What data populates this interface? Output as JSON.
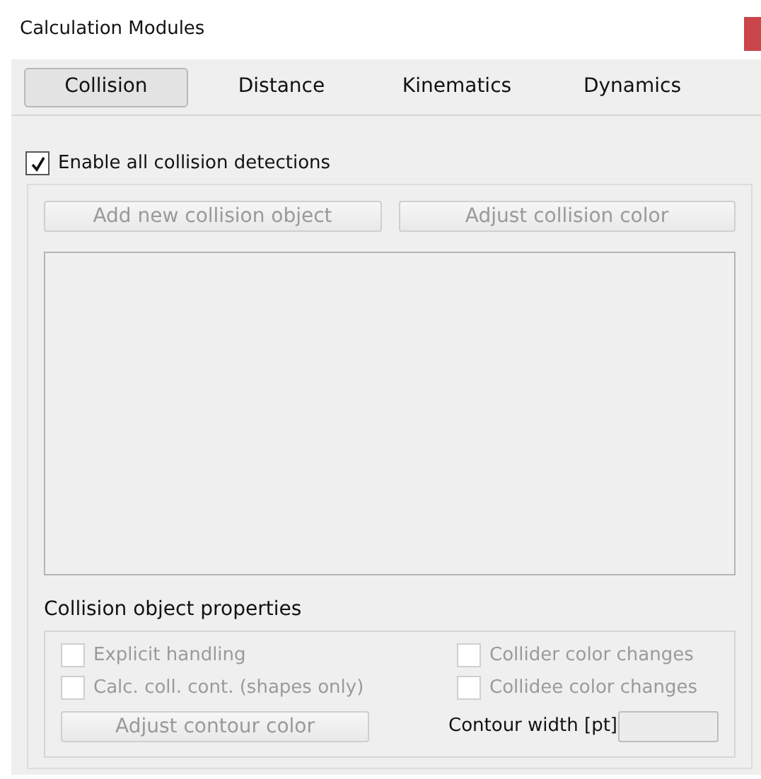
{
  "window": {
    "title": "Calculation Modules"
  },
  "tabs": [
    {
      "label": "Collision",
      "selected": true
    },
    {
      "label": "Distance",
      "selected": false
    },
    {
      "label": "Kinematics",
      "selected": false
    },
    {
      "label": "Dynamics",
      "selected": false
    }
  ],
  "enable_all": {
    "label": "Enable all collision detections",
    "checked": true
  },
  "buttons": [
    {
      "label": "Add new collision object",
      "disabled": true
    },
    {
      "label": "Adjust collision color",
      "disabled": true
    }
  ],
  "properties": {
    "title": "Collision object properties",
    "checkboxes": [
      {
        "label": "Explicit handling",
        "checked": false,
        "disabled": true
      },
      {
        "label": "Collider color changes",
        "checked": false,
        "disabled": true
      },
      {
        "label": "Calc. coll. cont. (shapes only)",
        "checked": false,
        "disabled": true
      },
      {
        "label": "Collidee color changes",
        "checked": false,
        "disabled": true
      }
    ],
    "contour_button": {
      "label": "Adjust contour color",
      "disabled": true
    },
    "contour_width_label": "Contour width [pt]",
    "contour_width_field": {
      "disabled": true
    }
  }
}
